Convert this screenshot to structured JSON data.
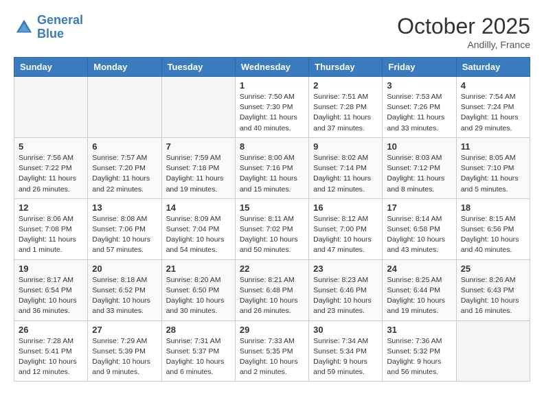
{
  "header": {
    "logo_line1": "General",
    "logo_line2": "Blue",
    "month_title": "October 2025",
    "location": "Andilly, France"
  },
  "days_of_week": [
    "Sunday",
    "Monday",
    "Tuesday",
    "Wednesday",
    "Thursday",
    "Friday",
    "Saturday"
  ],
  "weeks": [
    [
      {
        "num": "",
        "info": ""
      },
      {
        "num": "",
        "info": ""
      },
      {
        "num": "",
        "info": ""
      },
      {
        "num": "1",
        "info": "Sunrise: 7:50 AM\nSunset: 7:30 PM\nDaylight: 11 hours\nand 40 minutes."
      },
      {
        "num": "2",
        "info": "Sunrise: 7:51 AM\nSunset: 7:28 PM\nDaylight: 11 hours\nand 37 minutes."
      },
      {
        "num": "3",
        "info": "Sunrise: 7:53 AM\nSunset: 7:26 PM\nDaylight: 11 hours\nand 33 minutes."
      },
      {
        "num": "4",
        "info": "Sunrise: 7:54 AM\nSunset: 7:24 PM\nDaylight: 11 hours\nand 29 minutes."
      }
    ],
    [
      {
        "num": "5",
        "info": "Sunrise: 7:56 AM\nSunset: 7:22 PM\nDaylight: 11 hours\nand 26 minutes."
      },
      {
        "num": "6",
        "info": "Sunrise: 7:57 AM\nSunset: 7:20 PM\nDaylight: 11 hours\nand 22 minutes."
      },
      {
        "num": "7",
        "info": "Sunrise: 7:59 AM\nSunset: 7:18 PM\nDaylight: 11 hours\nand 19 minutes."
      },
      {
        "num": "8",
        "info": "Sunrise: 8:00 AM\nSunset: 7:16 PM\nDaylight: 11 hours\nand 15 minutes."
      },
      {
        "num": "9",
        "info": "Sunrise: 8:02 AM\nSunset: 7:14 PM\nDaylight: 11 hours\nand 12 minutes."
      },
      {
        "num": "10",
        "info": "Sunrise: 8:03 AM\nSunset: 7:12 PM\nDaylight: 11 hours\nand 8 minutes."
      },
      {
        "num": "11",
        "info": "Sunrise: 8:05 AM\nSunset: 7:10 PM\nDaylight: 11 hours\nand 5 minutes."
      }
    ],
    [
      {
        "num": "12",
        "info": "Sunrise: 8:06 AM\nSunset: 7:08 PM\nDaylight: 11 hours\nand 1 minute."
      },
      {
        "num": "13",
        "info": "Sunrise: 8:08 AM\nSunset: 7:06 PM\nDaylight: 10 hours\nand 57 minutes."
      },
      {
        "num": "14",
        "info": "Sunrise: 8:09 AM\nSunset: 7:04 PM\nDaylight: 10 hours\nand 54 minutes."
      },
      {
        "num": "15",
        "info": "Sunrise: 8:11 AM\nSunset: 7:02 PM\nDaylight: 10 hours\nand 50 minutes."
      },
      {
        "num": "16",
        "info": "Sunrise: 8:12 AM\nSunset: 7:00 PM\nDaylight: 10 hours\nand 47 minutes."
      },
      {
        "num": "17",
        "info": "Sunrise: 8:14 AM\nSunset: 6:58 PM\nDaylight: 10 hours\nand 43 minutes."
      },
      {
        "num": "18",
        "info": "Sunrise: 8:15 AM\nSunset: 6:56 PM\nDaylight: 10 hours\nand 40 minutes."
      }
    ],
    [
      {
        "num": "19",
        "info": "Sunrise: 8:17 AM\nSunset: 6:54 PM\nDaylight: 10 hours\nand 36 minutes."
      },
      {
        "num": "20",
        "info": "Sunrise: 8:18 AM\nSunset: 6:52 PM\nDaylight: 10 hours\nand 33 minutes."
      },
      {
        "num": "21",
        "info": "Sunrise: 8:20 AM\nSunset: 6:50 PM\nDaylight: 10 hours\nand 30 minutes."
      },
      {
        "num": "22",
        "info": "Sunrise: 8:21 AM\nSunset: 6:48 PM\nDaylight: 10 hours\nand 26 minutes."
      },
      {
        "num": "23",
        "info": "Sunrise: 8:23 AM\nSunset: 6:46 PM\nDaylight: 10 hours\nand 23 minutes."
      },
      {
        "num": "24",
        "info": "Sunrise: 8:25 AM\nSunset: 6:44 PM\nDaylight: 10 hours\nand 19 minutes."
      },
      {
        "num": "25",
        "info": "Sunrise: 8:26 AM\nSunset: 6:43 PM\nDaylight: 10 hours\nand 16 minutes."
      }
    ],
    [
      {
        "num": "26",
        "info": "Sunrise: 7:28 AM\nSunset: 5:41 PM\nDaylight: 10 hours\nand 12 minutes."
      },
      {
        "num": "27",
        "info": "Sunrise: 7:29 AM\nSunset: 5:39 PM\nDaylight: 10 hours\nand 9 minutes."
      },
      {
        "num": "28",
        "info": "Sunrise: 7:31 AM\nSunset: 5:37 PM\nDaylight: 10 hours\nand 6 minutes."
      },
      {
        "num": "29",
        "info": "Sunrise: 7:33 AM\nSunset: 5:35 PM\nDaylight: 10 hours\nand 2 minutes."
      },
      {
        "num": "30",
        "info": "Sunrise: 7:34 AM\nSunset: 5:34 PM\nDaylight: 9 hours\nand 59 minutes."
      },
      {
        "num": "31",
        "info": "Sunrise: 7:36 AM\nSunset: 5:32 PM\nDaylight: 9 hours\nand 56 minutes."
      },
      {
        "num": "",
        "info": ""
      }
    ]
  ]
}
